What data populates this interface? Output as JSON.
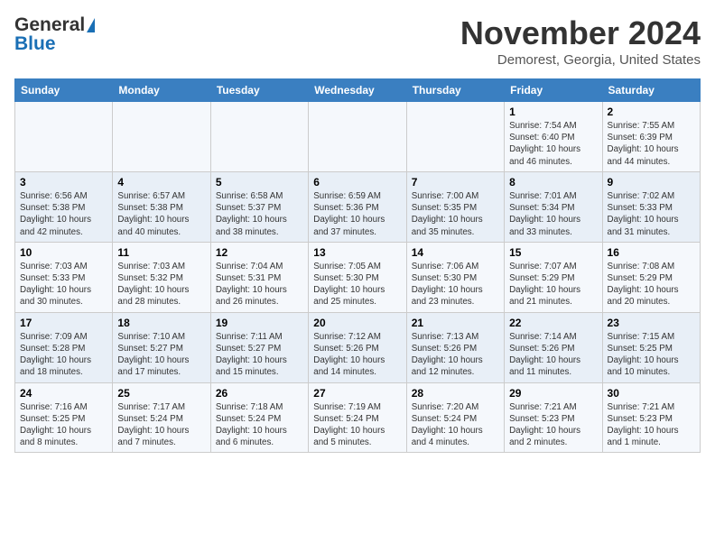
{
  "header": {
    "logo_general": "General",
    "logo_blue": "Blue",
    "month": "November 2024",
    "location": "Demorest, Georgia, United States"
  },
  "weekdays": [
    "Sunday",
    "Monday",
    "Tuesday",
    "Wednesday",
    "Thursday",
    "Friday",
    "Saturday"
  ],
  "weeks": [
    [
      {
        "day": "",
        "info": ""
      },
      {
        "day": "",
        "info": ""
      },
      {
        "day": "",
        "info": ""
      },
      {
        "day": "",
        "info": ""
      },
      {
        "day": "",
        "info": ""
      },
      {
        "day": "1",
        "info": "Sunrise: 7:54 AM\nSunset: 6:40 PM\nDaylight: 10 hours\nand 46 minutes."
      },
      {
        "day": "2",
        "info": "Sunrise: 7:55 AM\nSunset: 6:39 PM\nDaylight: 10 hours\nand 44 minutes."
      }
    ],
    [
      {
        "day": "3",
        "info": "Sunrise: 6:56 AM\nSunset: 5:38 PM\nDaylight: 10 hours\nand 42 minutes."
      },
      {
        "day": "4",
        "info": "Sunrise: 6:57 AM\nSunset: 5:38 PM\nDaylight: 10 hours\nand 40 minutes."
      },
      {
        "day": "5",
        "info": "Sunrise: 6:58 AM\nSunset: 5:37 PM\nDaylight: 10 hours\nand 38 minutes."
      },
      {
        "day": "6",
        "info": "Sunrise: 6:59 AM\nSunset: 5:36 PM\nDaylight: 10 hours\nand 37 minutes."
      },
      {
        "day": "7",
        "info": "Sunrise: 7:00 AM\nSunset: 5:35 PM\nDaylight: 10 hours\nand 35 minutes."
      },
      {
        "day": "8",
        "info": "Sunrise: 7:01 AM\nSunset: 5:34 PM\nDaylight: 10 hours\nand 33 minutes."
      },
      {
        "day": "9",
        "info": "Sunrise: 7:02 AM\nSunset: 5:33 PM\nDaylight: 10 hours\nand 31 minutes."
      }
    ],
    [
      {
        "day": "10",
        "info": "Sunrise: 7:03 AM\nSunset: 5:33 PM\nDaylight: 10 hours\nand 30 minutes."
      },
      {
        "day": "11",
        "info": "Sunrise: 7:03 AM\nSunset: 5:32 PM\nDaylight: 10 hours\nand 28 minutes."
      },
      {
        "day": "12",
        "info": "Sunrise: 7:04 AM\nSunset: 5:31 PM\nDaylight: 10 hours\nand 26 minutes."
      },
      {
        "day": "13",
        "info": "Sunrise: 7:05 AM\nSunset: 5:30 PM\nDaylight: 10 hours\nand 25 minutes."
      },
      {
        "day": "14",
        "info": "Sunrise: 7:06 AM\nSunset: 5:30 PM\nDaylight: 10 hours\nand 23 minutes."
      },
      {
        "day": "15",
        "info": "Sunrise: 7:07 AM\nSunset: 5:29 PM\nDaylight: 10 hours\nand 21 minutes."
      },
      {
        "day": "16",
        "info": "Sunrise: 7:08 AM\nSunset: 5:29 PM\nDaylight: 10 hours\nand 20 minutes."
      }
    ],
    [
      {
        "day": "17",
        "info": "Sunrise: 7:09 AM\nSunset: 5:28 PM\nDaylight: 10 hours\nand 18 minutes."
      },
      {
        "day": "18",
        "info": "Sunrise: 7:10 AM\nSunset: 5:27 PM\nDaylight: 10 hours\nand 17 minutes."
      },
      {
        "day": "19",
        "info": "Sunrise: 7:11 AM\nSunset: 5:27 PM\nDaylight: 10 hours\nand 15 minutes."
      },
      {
        "day": "20",
        "info": "Sunrise: 7:12 AM\nSunset: 5:26 PM\nDaylight: 10 hours\nand 14 minutes."
      },
      {
        "day": "21",
        "info": "Sunrise: 7:13 AM\nSunset: 5:26 PM\nDaylight: 10 hours\nand 12 minutes."
      },
      {
        "day": "22",
        "info": "Sunrise: 7:14 AM\nSunset: 5:26 PM\nDaylight: 10 hours\nand 11 minutes."
      },
      {
        "day": "23",
        "info": "Sunrise: 7:15 AM\nSunset: 5:25 PM\nDaylight: 10 hours\nand 10 minutes."
      }
    ],
    [
      {
        "day": "24",
        "info": "Sunrise: 7:16 AM\nSunset: 5:25 PM\nDaylight: 10 hours\nand 8 minutes."
      },
      {
        "day": "25",
        "info": "Sunrise: 7:17 AM\nSunset: 5:24 PM\nDaylight: 10 hours\nand 7 minutes."
      },
      {
        "day": "26",
        "info": "Sunrise: 7:18 AM\nSunset: 5:24 PM\nDaylight: 10 hours\nand 6 minutes."
      },
      {
        "day": "27",
        "info": "Sunrise: 7:19 AM\nSunset: 5:24 PM\nDaylight: 10 hours\nand 5 minutes."
      },
      {
        "day": "28",
        "info": "Sunrise: 7:20 AM\nSunset: 5:24 PM\nDaylight: 10 hours\nand 4 minutes."
      },
      {
        "day": "29",
        "info": "Sunrise: 7:21 AM\nSunset: 5:23 PM\nDaylight: 10 hours\nand 2 minutes."
      },
      {
        "day": "30",
        "info": "Sunrise: 7:21 AM\nSunset: 5:23 PM\nDaylight: 10 hours\nand 1 minute."
      }
    ]
  ]
}
